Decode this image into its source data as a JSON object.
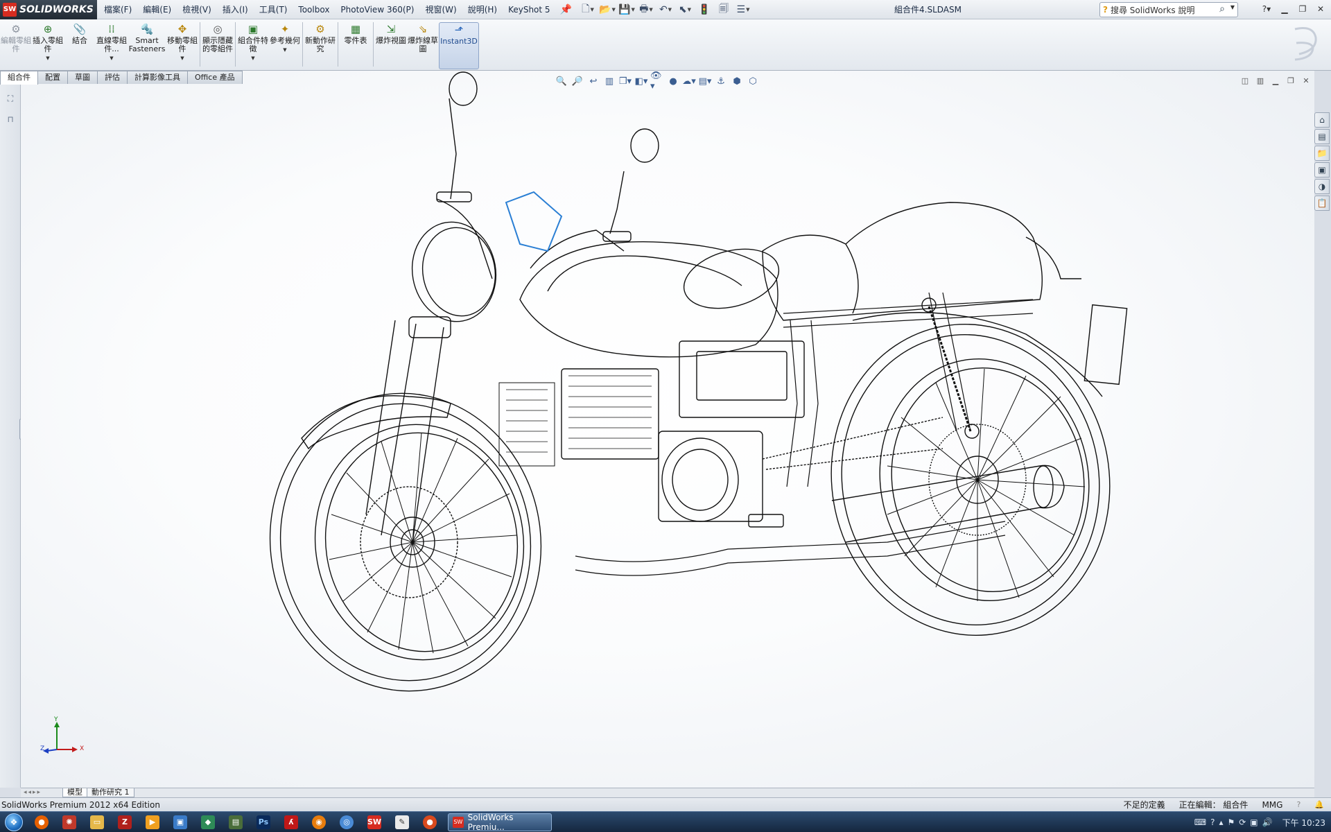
{
  "app": {
    "logo_text": "SOLIDWORKS",
    "document_title": "組合件4.SLDASM"
  },
  "menus": [
    "檔案(F)",
    "編輯(E)",
    "檢視(V)",
    "插入(I)",
    "工具(T)",
    "Toolbox",
    "PhotoView 360(P)",
    "視窗(W)",
    "說明(H)",
    "KeyShot 5"
  ],
  "search": {
    "placeholder": "搜尋 SolidWorks 說明"
  },
  "command_manager": {
    "tools": [
      {
        "label": "編輯零組件",
        "icon": "edit-component-icon",
        "enabled": false
      },
      {
        "label": "插入零組件",
        "icon": "insert-component-icon",
        "enabled": true
      },
      {
        "label": "結合",
        "icon": "mate-icon",
        "enabled": true
      },
      {
        "label": "直線零組件...",
        "icon": "linear-pattern-icon",
        "enabled": true
      },
      {
        "label": "Smart Fasteners",
        "icon": "smart-fasteners-icon",
        "enabled": true
      },
      {
        "label": "移動零組件",
        "icon": "move-component-icon",
        "enabled": true
      },
      {
        "label": "顯示隱藏的零組件",
        "icon": "show-hidden-icon",
        "enabled": true
      },
      {
        "label": "組合件特徵",
        "icon": "assembly-features-icon",
        "enabled": true
      },
      {
        "label": "參考幾何",
        "icon": "reference-geometry-icon",
        "enabled": true
      },
      {
        "label": "新動作研究",
        "icon": "motion-study-icon",
        "enabled": true
      },
      {
        "label": "零件表",
        "icon": "bom-icon",
        "enabled": true
      },
      {
        "label": "爆炸視圖",
        "icon": "exploded-view-icon",
        "enabled": true
      },
      {
        "label": "爆炸線草圖",
        "icon": "explode-line-sketch-icon",
        "enabled": true
      },
      {
        "label": "Instant3D",
        "icon": "instant3d-icon",
        "enabled": true,
        "active": true
      }
    ]
  },
  "tabs": [
    {
      "label": "組合件",
      "active": true
    },
    {
      "label": "配置"
    },
    {
      "label": "草圖"
    },
    {
      "label": "評估"
    },
    {
      "label": "計算影像工具"
    },
    {
      "label": "Office 產品"
    }
  ],
  "model_tabs": [
    {
      "label": "模型",
      "active": true
    },
    {
      "label": "動作研究 1"
    }
  ],
  "triad": {
    "x": "X",
    "y": "Y",
    "z": "Z"
  },
  "status": {
    "left": "SolidWorks Premium 2012 x64 Edition",
    "definition": "不足的定義",
    "editing": "正在編輯： 組合件",
    "units": "MMG",
    "help": "?"
  },
  "taskbar": {
    "active_window_label": "SolidWorks Premiu...",
    "clock": "下午 10:23"
  },
  "colors": {
    "accent": "#3b5e91",
    "solidworks_red": "#d62c20",
    "taskbar": "#1c3354"
  }
}
